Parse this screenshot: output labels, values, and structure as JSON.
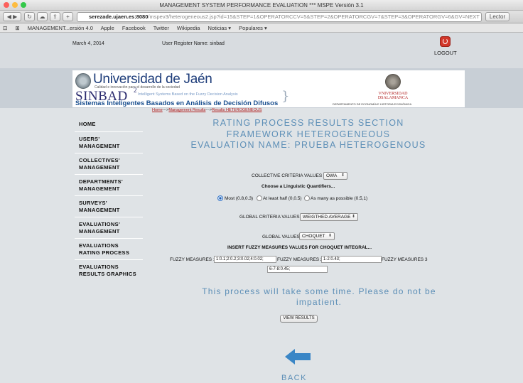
{
  "browser": {
    "window_title": "MANAGEMENT SYSTEM PERFORMANCE EVALUATION *** MSPE Versión 3.1",
    "url_host": "serezade.ujaen.es:8080",
    "url_path": "/mspev3/heterogeneous2.jsp?id=15&STEP=1&OPERATORCCV=5&STEP=2&OPERATORCGV=7&STEP=3&OPERATORGV=6&GV=NEXT",
    "reader_label": "Lector",
    "bookmarks": [
      "MANAGEMENT...ersión 4.0",
      "Apple",
      "Facebook",
      "Twitter",
      "Wikipedia",
      "Noticias ▾",
      "Populares ▾"
    ]
  },
  "header": {
    "date": "March 4, 2014",
    "user": "User Register Name: sinbad",
    "logout": "LOGOUT"
  },
  "banner": {
    "uja_title": "Universidad de Jaén",
    "uja_sub": "Calidad e innovación para el desarrollo de la sociedad",
    "sinbad": "SINBAD",
    "sinbad_sup": "2",
    "sinbad_tag": "Intelligent Systems Based on the Fuzzy Decision Analysis",
    "sinbad_es": "Sistemas Inteligentes Basados en Análisis de Decisión Difusos",
    "usal_line1": "VNIVERSIDAD",
    "usal_line2": "DSALAMANCA",
    "usal_dept": "DEPARTAMENTO DE ECONOMÍA E HISTORIA ECONÓMICA"
  },
  "breadcrumb": {
    "home": "Home",
    "sep": "--->",
    "results": "Management Results",
    "current": "Results HETEROGENEOUS"
  },
  "sidebar": {
    "items": [
      "HOME",
      "USERS' MANAGEMENT",
      "COLLECTIVES' MANAGEMENT",
      "DEPARTMENTS' MANAGEMENT",
      "SURVEYS' MANAGEMENT",
      "EVALUATIONS' MANAGEMENT",
      "EVALUATIONS RATING PROCESS",
      "EVALUATIONS RESULTS GRAPHICS"
    ]
  },
  "main": {
    "title1": "RATING PROCESS RESULTS SECTION",
    "title2": "FRAMEWORK HETEROGENEOUS",
    "title3": "EVALUATION NAME: PRUEBA HETEROGENOUS",
    "collective_label": "COLLECTIVE CRITERIA VALUES",
    "collective_value": "OWA",
    "quantifiers_label": "Choose a Linguistic Quantifiers...",
    "quantifiers": [
      {
        "label": "Most (0.8,0.3)",
        "checked": true
      },
      {
        "label": "At least half (0,0.5)",
        "checked": false
      },
      {
        "label": "As many as possible (0.5,1)",
        "checked": false
      }
    ],
    "global_criteria_label": "GLOBAL CRITERIA VALUES",
    "global_criteria_value": "WEIGTHED AVERAGE",
    "global_values_label": "GLOBAL VALUES",
    "global_values_value": "CHOQUET",
    "insert_label": "INSERT FUZZY MEASURES VALUES FOR CHOQUET INTEGRAL...",
    "fm1_label": "FUZZY MEASURES 1",
    "fm1_value": "1:0.1;2:0.2;3:0.02;4:0.02;",
    "fm2_label": "FUZZY MEASURES 2",
    "fm2_value": "1-2:0.43;",
    "fm3_label": "FUZZY MEASURES 3",
    "fm3_value": "6-7-8:0.45;",
    "notice1": "This process will take some time. Please do not be",
    "notice2": "impatient.",
    "view_results": "VIEW RESULTS",
    "back": "BACK"
  },
  "colors": {
    "accent": "#5d8fb7",
    "back_arrow": "#3a86c6",
    "link_red": "#b01818"
  }
}
